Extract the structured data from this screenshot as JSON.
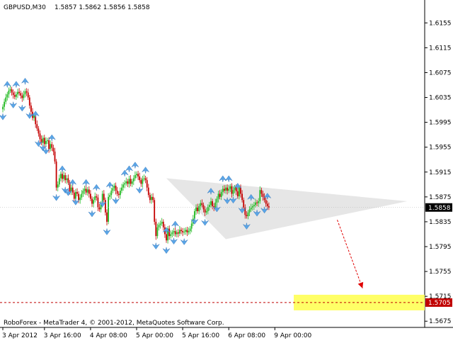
{
  "header": {
    "symbol_label": "GBPUSD,M30",
    "ohlc_label": "1.5857 1.5862 1.5856 1.5858"
  },
  "footer": {
    "copyright": "RoboForex - MetaTrader 4, © 2001-2012, MetaQuotes Software Corp."
  },
  "colors": {
    "bull_candle": "#22b922",
    "bear_candle": "#c40000",
    "fractal": "#5aa6e8",
    "triangle_fill": "#e6e6e6",
    "target_zone": "#ffff66",
    "target_line": "#c00000",
    "forecast_arrow": "#e00000",
    "grid": "#c8c8c8"
  },
  "chart_data": {
    "type": "candlestick",
    "ylim": [
      1.5665,
      1.6185
    ],
    "y_ticks": [
      "1.6155",
      "1.6115",
      "1.6075",
      "1.6035",
      "1.5995",
      "1.5955",
      "1.5915",
      "1.5875",
      "1.5835",
      "1.5795",
      "1.5755",
      "1.5715",
      "1.5675"
    ],
    "x_ticks": [
      {
        "label": "3 Apr 2012",
        "index": 0
      },
      {
        "label": "3 Apr 16:00",
        "index": 28
      },
      {
        "label": "4 Apr 08:00",
        "index": 59
      },
      {
        "label": "5 Apr 00:00",
        "index": 90
      },
      {
        "label": "5 Apr 16:00",
        "index": 121
      },
      {
        "label": "6 Apr 08:00",
        "index": 152
      },
      {
        "label": "9 Apr 00:00",
        "index": 183
      }
    ],
    "current_price": "1.5858",
    "target_level": "1.5705",
    "triangle": {
      "apex": {
        "index": 272,
        "price": 1.5868
      },
      "top": {
        "index": 110,
        "price": 1.5905
      },
      "bottom": {
        "index": 150,
        "price": 1.5807
      }
    },
    "forecast_arrow": {
      "from": {
        "index": 225,
        "price": 1.5838
      },
      "to": {
        "index": 242,
        "price": 1.5728
      }
    },
    "closes": [
      1.602,
      1.6028,
      1.6035,
      1.604,
      1.6046,
      1.6048,
      1.6043,
      1.6039,
      1.6036,
      1.604,
      1.6044,
      1.6042,
      1.6038,
      1.6034,
      1.604,
      1.6045,
      1.6043,
      1.6035,
      1.6022,
      1.6012,
      1.6002,
      1.6006,
      1.5992,
      1.5985,
      1.5977,
      1.5968,
      1.5962,
      1.597,
      1.596,
      1.5965,
      1.5966,
      1.5952,
      1.596,
      1.5954,
      1.5948,
      1.5932,
      1.589,
      1.5895,
      1.5905,
      1.5912,
      1.5904,
      1.591,
      1.5902,
      1.5905,
      1.5898,
      1.5884,
      1.589,
      1.5882,
      1.5872,
      1.5883,
      1.588,
      1.587,
      1.5874,
      1.588,
      1.5885,
      1.5888,
      1.5882,
      1.5887,
      1.588,
      1.5872,
      1.5864,
      1.587,
      1.5876,
      1.5874,
      1.5858,
      1.5855,
      1.5864,
      1.588,
      1.587,
      1.585,
      1.5835,
      1.5875,
      1.5878,
      1.5885,
      1.5889,
      1.5893,
      1.5885,
      1.588,
      1.5878,
      1.5885,
      1.589,
      1.5895,
      1.5897,
      1.59,
      1.5896,
      1.5904,
      1.5896,
      1.59,
      1.5905,
      1.591,
      1.5912,
      1.5908,
      1.5902,
      1.5896,
      1.5904,
      1.5905,
      1.5902,
      1.589,
      1.5878,
      1.587,
      1.5875,
      1.587,
      1.5835,
      1.5812,
      1.5826,
      1.583,
      1.5832,
      1.5835,
      1.5826,
      1.5815,
      1.5805,
      1.5824,
      1.5812,
      1.5815,
      1.5818,
      1.582,
      1.5815,
      1.5818,
      1.5816,
      1.5822,
      1.582,
      1.5818,
      1.5819,
      1.5822,
      1.5818,
      1.582,
      1.5824,
      1.5832,
      1.584,
      1.5852,
      1.5858,
      1.5852,
      1.586,
      1.5865,
      1.5862,
      1.5855,
      1.585,
      1.5852,
      1.5859,
      1.5862,
      1.5868,
      1.586,
      1.5858,
      1.5866,
      1.5872,
      1.588,
      1.5875,
      1.5883,
      1.5888,
      1.5885,
      1.589,
      1.5885,
      1.5888,
      1.5892,
      1.588,
      1.5886,
      1.589,
      1.5884,
      1.5876,
      1.589,
      1.588,
      1.587,
      1.5858,
      1.5846,
      1.5844,
      1.585,
      1.5855,
      1.5858,
      1.586,
      1.5862,
      1.5866,
      1.5865,
      1.5868,
      1.5886,
      1.588,
      1.5875,
      1.587,
      1.5864,
      1.586,
      1.5858
    ],
    "fractals_up": [
      3,
      9,
      15,
      22,
      33,
      40,
      47,
      56,
      63,
      72,
      82,
      85,
      89,
      96,
      110,
      116,
      140,
      148,
      152,
      158,
      167,
      178,
      185
    ],
    "fractals_down": [
      0,
      7,
      13,
      18,
      24,
      27,
      29,
      36,
      42,
      44,
      49,
      60,
      67,
      70,
      76,
      92,
      103,
      110,
      115,
      122,
      129,
      136,
      144,
      151,
      155,
      161,
      164,
      171,
      176,
      180
    ]
  }
}
